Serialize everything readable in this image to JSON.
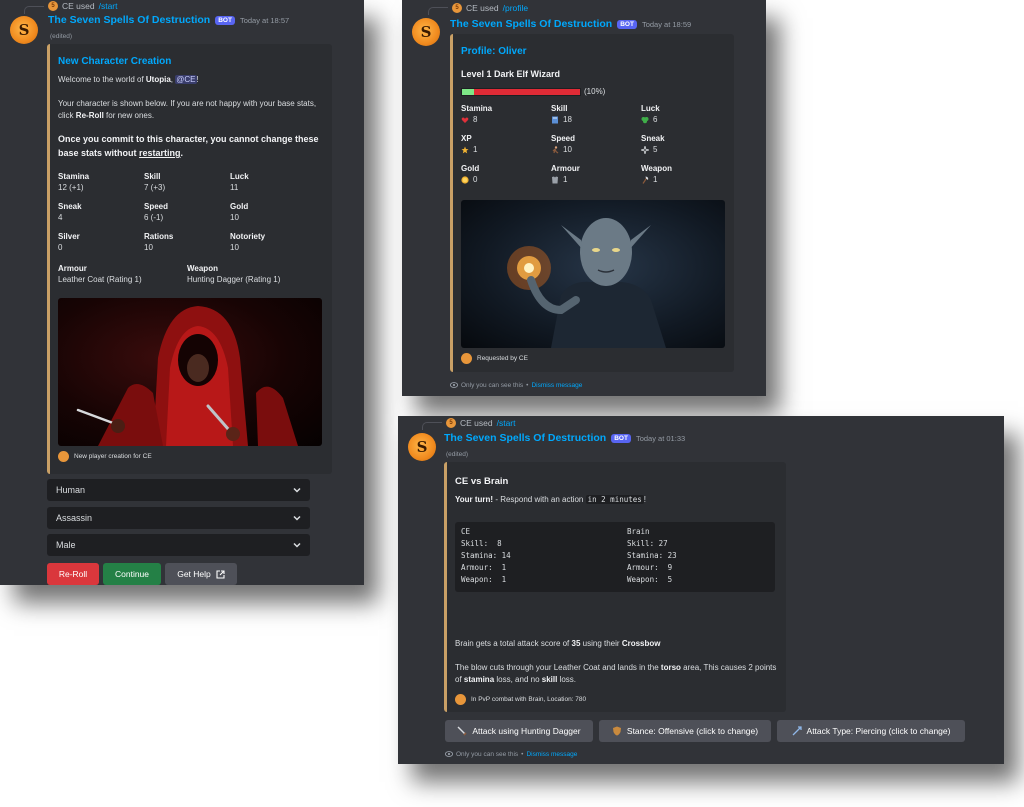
{
  "colors": {
    "background": "#313338",
    "embed_accent": "#c9a066",
    "link": "#00a8fc",
    "bot_tag": "#5865f2",
    "reroll": "#da373c",
    "continue": "#248046",
    "help": "#4e5058"
  },
  "panel1": {
    "reply": {
      "user": "CE used",
      "command": "/start"
    },
    "bot_name": "The Seven Spells Of Destruction",
    "bot_tag": "BOT",
    "time": "Today at 18:57",
    "edited": "(edited)",
    "embed": {
      "title": "New Character Creation",
      "welcome_prefix": "Welcome to the world of",
      "world": "Utopia",
      "comma": ",",
      "mention": "@CE",
      "welcome_suffix": "!",
      "shown_prefix": "Your character is shown below. If you are not happy with your base stats, click",
      "reroll_word": "Re-Roll",
      "shown_suffix": "for new ones.",
      "commit_text": "Once you commit to this character, you cannot change these base stats without",
      "restarting": "restarting",
      "period": ".",
      "fields": [
        {
          "name": "Stamina",
          "value": "12 (+1)"
        },
        {
          "name": "Skill",
          "value": "7 (+3)"
        },
        {
          "name": "Luck",
          "value": "11"
        },
        {
          "name": "Sneak",
          "value": "4"
        },
        {
          "name": "Speed",
          "value": "6 (-1)"
        },
        {
          "name": "Gold",
          "value": "10"
        },
        {
          "name": "Silver",
          "value": "0"
        },
        {
          "name": "Rations",
          "value": "10"
        },
        {
          "name": "Notoriety",
          "value": "10"
        }
      ],
      "armour": {
        "name": "Armour",
        "value": "Leather Coat (Rating 1)"
      },
      "weapon": {
        "name": "Weapon",
        "value": "Hunting Dagger (Rating 1)"
      },
      "footer": "New player creation for CE"
    },
    "selects": [
      "Human",
      "Assassin",
      "Male"
    ],
    "buttons": {
      "reroll": "Re-Roll",
      "continue": "Continue",
      "help": "Get Help"
    }
  },
  "panel2": {
    "reply": {
      "user": "CE used",
      "command": "/profile"
    },
    "bot_name": "The Seven Spells Of Destruction",
    "bot_tag": "BOT",
    "time": "Today at 18:59",
    "embed": {
      "title": "Profile: Oliver",
      "subtitle": "Level 1 Dark Elf Wizard",
      "xp_progress": 0.1,
      "xp_percent_label": "(10%)",
      "fields": [
        {
          "name": "Stamina",
          "value": "8",
          "icon": "heart-icon"
        },
        {
          "name": "Skill",
          "value": "18",
          "icon": "book-icon"
        },
        {
          "name": "Luck",
          "value": "6",
          "icon": "clover-icon"
        },
        {
          "name": "XP",
          "value": "1",
          "icon": "star-icon"
        },
        {
          "name": "Speed",
          "value": "10",
          "icon": "running-icon"
        },
        {
          "name": "Sneak",
          "value": "5",
          "icon": "sparkle-icon"
        },
        {
          "name": "Gold",
          "value": "0",
          "icon": "coin-icon"
        },
        {
          "name": "Armour",
          "value": "1",
          "icon": "armour-icon"
        },
        {
          "name": "Weapon",
          "value": "1",
          "icon": "axe-icon"
        }
      ],
      "footer": "Requested by CE"
    },
    "ephemeral": {
      "text": "Only you can see this",
      "dot": "•",
      "dismiss": "Dismiss message"
    }
  },
  "panel3": {
    "reply": {
      "user": "CE used",
      "command": "/start"
    },
    "bot_name": "The Seven Spells Of Destruction",
    "bot_tag": "BOT",
    "time": "Today at 01:33",
    "edited": "(edited)",
    "embed": {
      "title": "CE vs Brain",
      "turn_bold": "Your turn!",
      "turn_text": "- Respond with an action",
      "turn_code": "in 2 minutes",
      "turn_end": "!",
      "left_stats": [
        "CE",
        "Skill:  8",
        "Stamina: 14",
        "Armour:  1",
        "Weapon:  1"
      ],
      "right_stats": [
        "Brain",
        "Skill: 27",
        "Stamina: 23",
        "Armour:  9",
        "Weapon:  5"
      ],
      "attack_prefix": "Brain gets a total attack score of",
      "attack_score": "35",
      "attack_mid": "using their",
      "attack_weapon": "Crossbow",
      "blow_prefix": "The blow cuts through your Leather Coat and lands in the",
      "blow_area": "torso",
      "blow_mid": "area, This causes 2 points of",
      "blow_stat": "stamina",
      "blow_mid2": "loss, and no",
      "blow_stat2": "skill",
      "blow_end": "loss.",
      "footer": "In PvP combat with Brain, Location: 780"
    },
    "buttons": {
      "attack": "Attack using Hunting Dagger",
      "stance": "Stance: Offensive (click to change)",
      "attack_type": "Attack Type: Piercing (click to change)"
    },
    "ephemeral": {
      "text": "Only you can see this",
      "dot": "•",
      "dismiss": "Dismiss message"
    }
  }
}
